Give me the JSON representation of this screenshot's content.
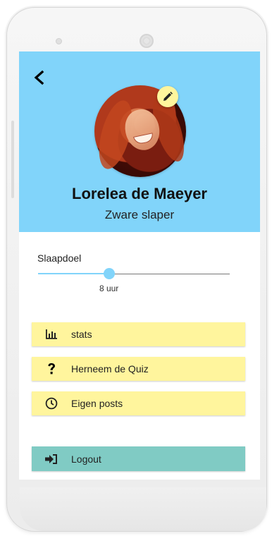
{
  "profile": {
    "name": "Lorelea de Maeyer",
    "subtitle": "Zware slaper"
  },
  "sleep_goal": {
    "label": "Slaapdoel",
    "value_text": "8 uur",
    "level_fraction": 0.37
  },
  "menu": {
    "stats_label": "stats",
    "quiz_label": "Herneem de Quiz",
    "posts_label": "Eigen posts",
    "logout_label": "Logout"
  },
  "icons": {
    "back": "back-arrow-icon",
    "edit": "pencil-icon",
    "stats": "bar-chart-icon",
    "quiz": "question-mark-icon",
    "posts": "clock-icon",
    "logout": "sign-out-icon"
  },
  "colors": {
    "header": "#81d4fa",
    "button": "#fff59d",
    "logout": "#80cbc4"
  }
}
